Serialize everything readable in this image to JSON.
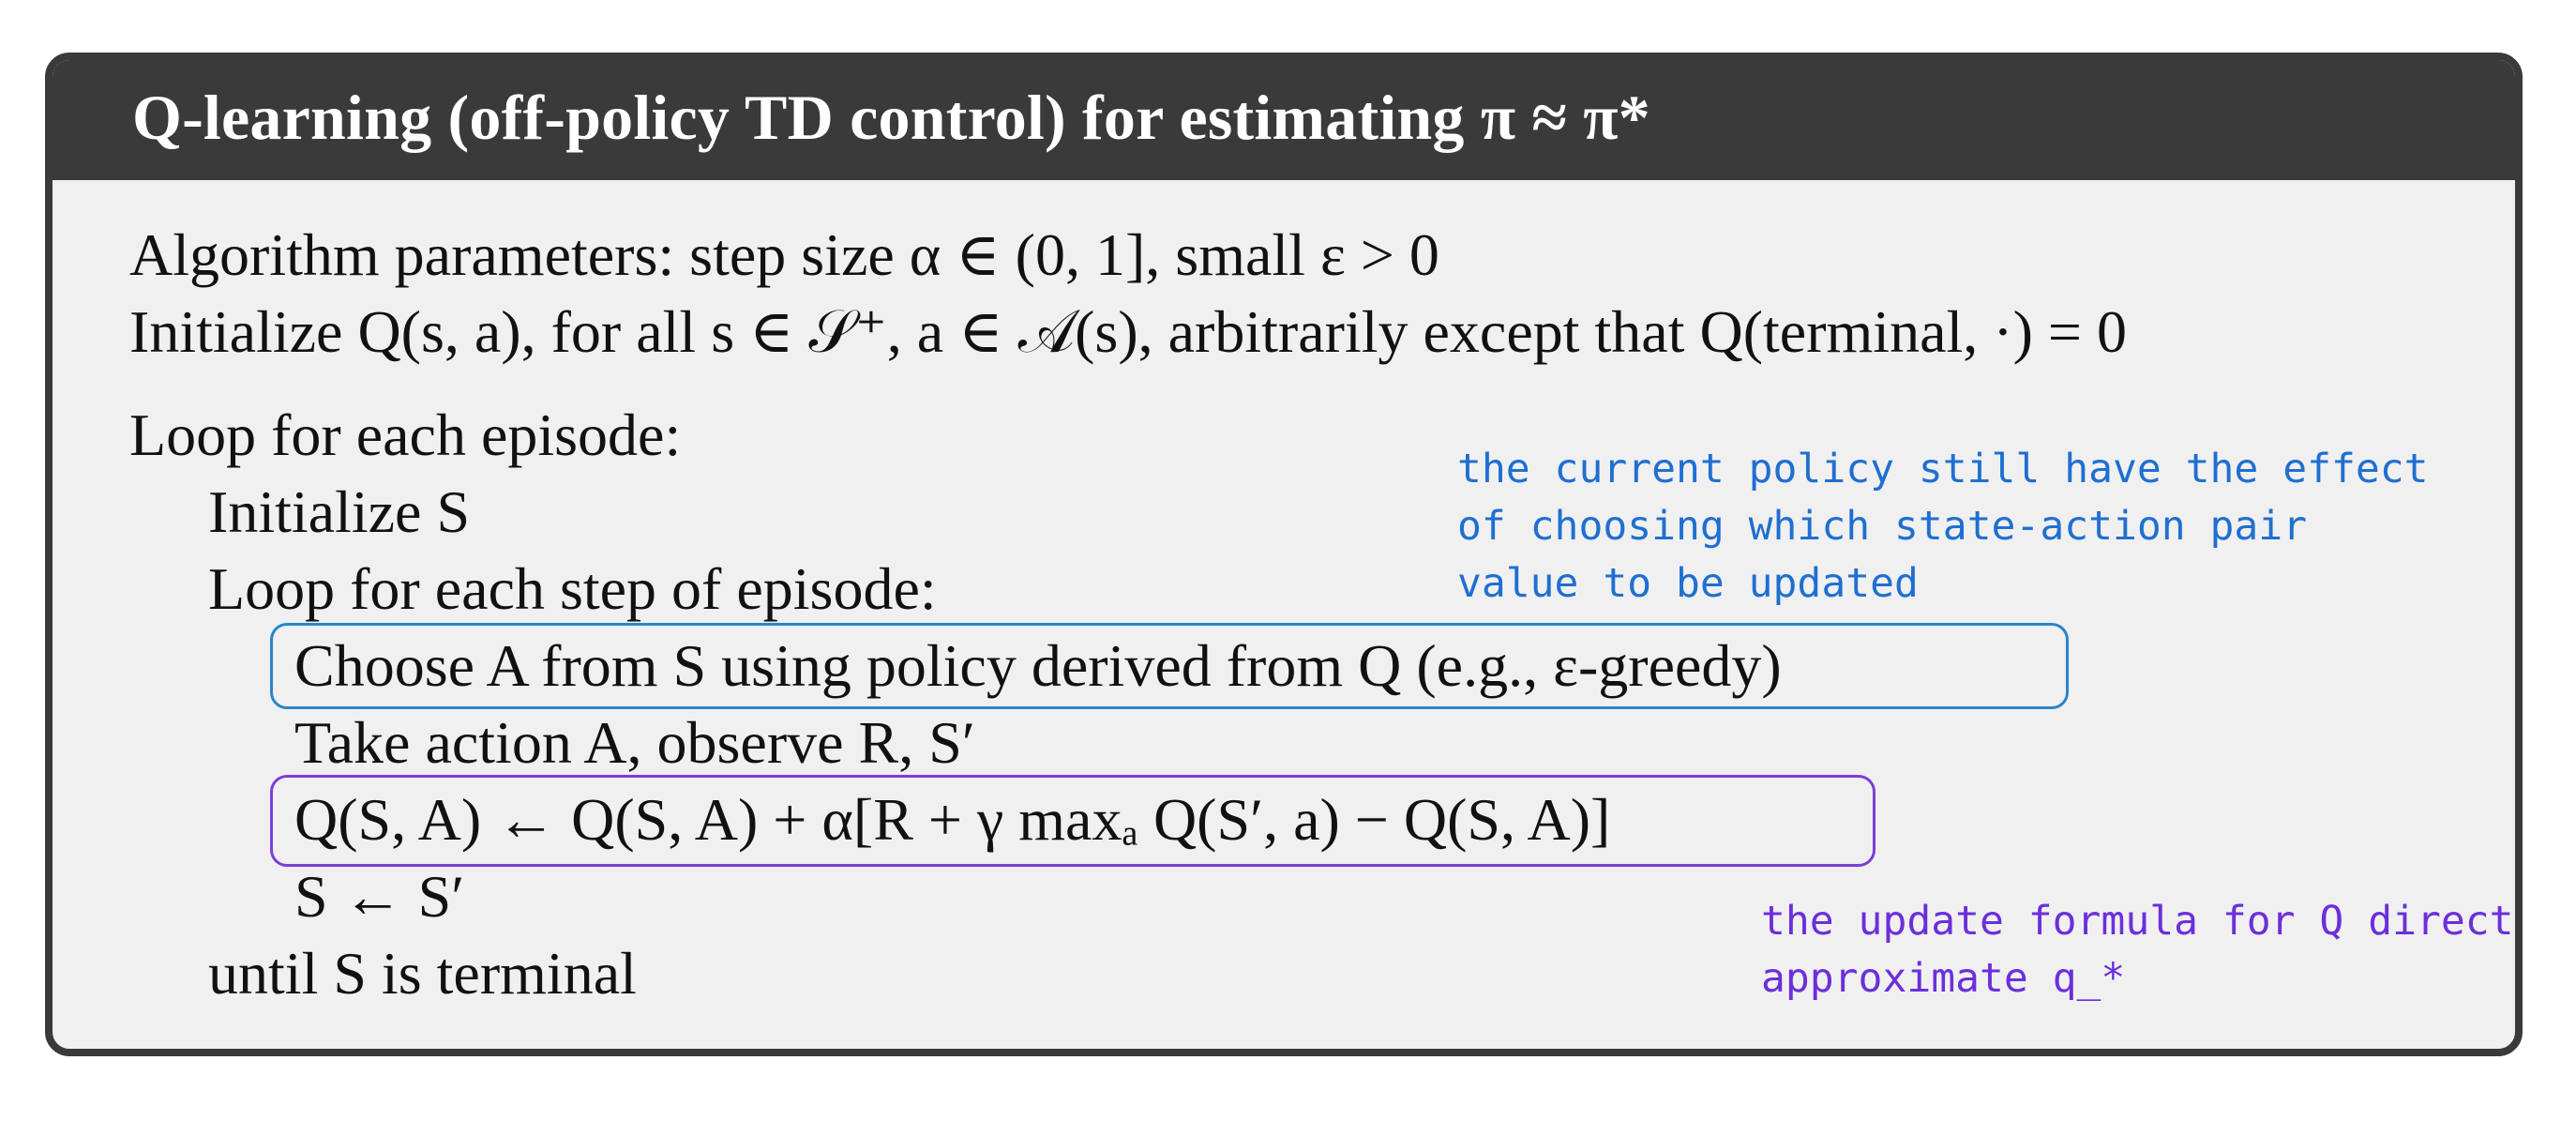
{
  "algorithm": {
    "title": "Q-learning (off-policy TD control) for estimating π ≈ π*",
    "lines": {
      "params": "Algorithm parameters: step size α ∈ (0, 1], small ε > 0",
      "init_q": "Initialize Q(s, a), for all s ∈ 𝒮⁺, a ∈ 𝒜(s), arbitrarily except that Q(terminal, ·) = 0",
      "loop_episode": "Loop for each episode:",
      "init_s": "Initialize S",
      "loop_step": "Loop for each step of episode:",
      "choose": "Choose A from S using policy derived from Q (e.g., ε-greedy)",
      "take": "Take action A, observe R, S′",
      "update": "Q(S, A) ← Q(S, A) + α[R + γ maxₐ Q(S′, a) − Q(S, A)]",
      "assign": "S ← S′",
      "until": "until S is terminal"
    }
  },
  "annotations": {
    "policy_note": "the current policy still have the effect\nof choosing which state-action pair\nvalue to be updated",
    "update_note": "the update formula for Q directly\napproximate q_*"
  },
  "colors": {
    "header_bg": "#3a3a3a",
    "box_bg": "#f0f0f0",
    "annotation_blue": "#1f6fd1",
    "annotation_purple": "#6b2fdb"
  }
}
